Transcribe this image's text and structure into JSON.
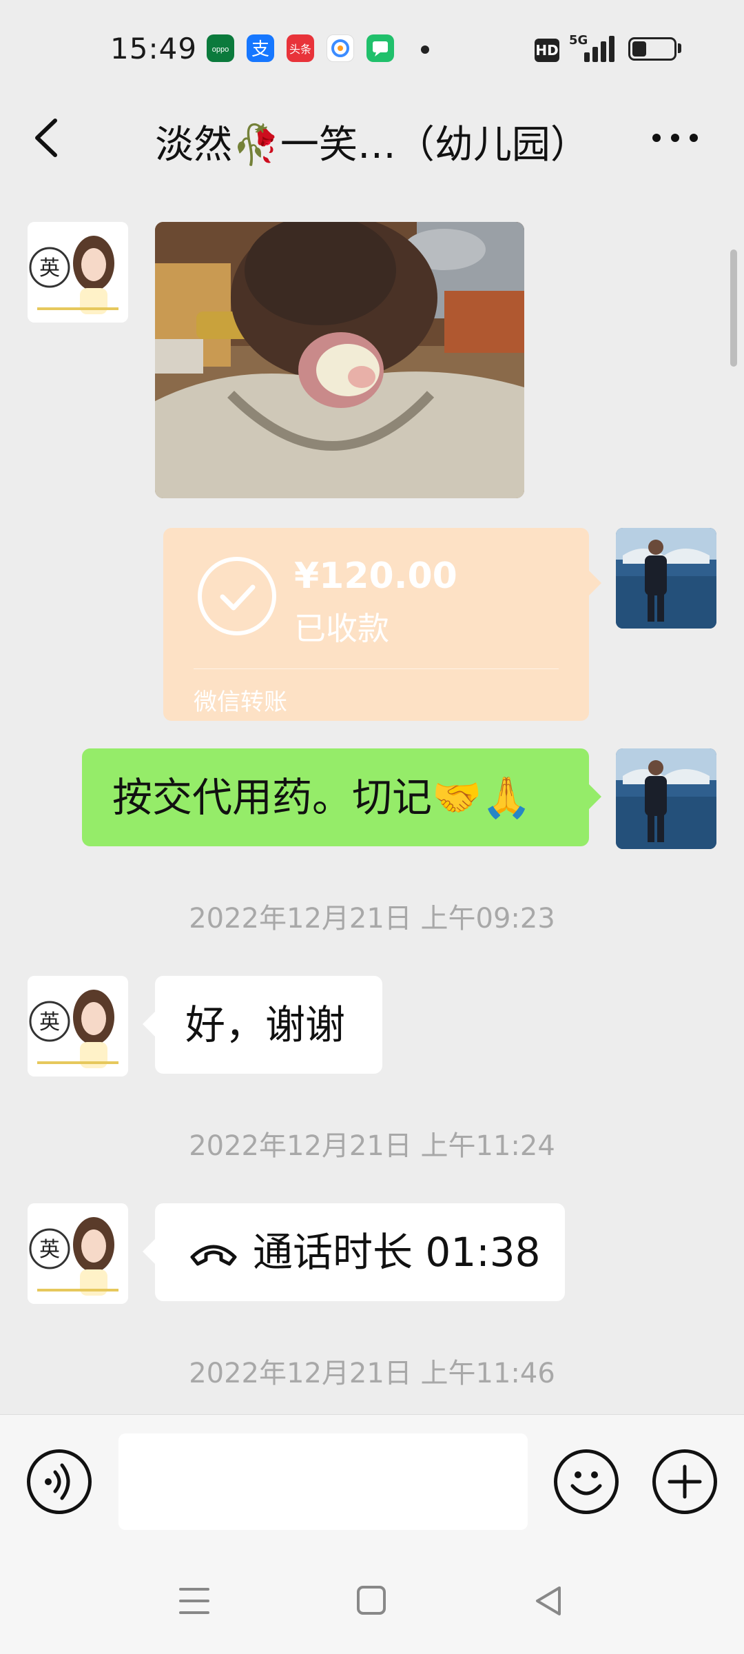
{
  "status_bar": {
    "time": "15:49",
    "network_badge": "HD",
    "network_type": "5G",
    "app_icons": [
      "oppo-app-icon",
      "alipay-icon",
      "toutiao-icon",
      "browser-icon",
      "chat-app-icon"
    ],
    "battery_level": 0.35
  },
  "header": {
    "title": "淡然🥀一笑…（幼儿园）",
    "back_icon": "chevron-left-icon",
    "more_icon": "more-dots-icon"
  },
  "messages": {
    "transfer": {
      "amount": "¥120.00",
      "status": "已收款",
      "footer": "微信转账"
    },
    "green_text": "按交代用药。切记🤝🙏",
    "time1": "2022年12月21日 上午09:23",
    "reply_text": "好，谢谢",
    "time2": "2022年12月21日 上午11:24",
    "call_text": "通话时长 01:38",
    "time3": "2022年12月21日 上午11:46"
  },
  "input_bar": {
    "voice_icon": "voice-icon",
    "emoji_icon": "emoji-icon",
    "plus_icon": "plus-icon",
    "placeholder": ""
  },
  "nav_bar": {
    "icons": [
      "menu-icon",
      "home-square-icon",
      "back-triangle-icon"
    ]
  },
  "colors": {
    "background": "#ededed",
    "sent_bubble": "#95ec69",
    "transfer_bubble": "#fde1c5",
    "timestamp": "#a8a8a8"
  }
}
